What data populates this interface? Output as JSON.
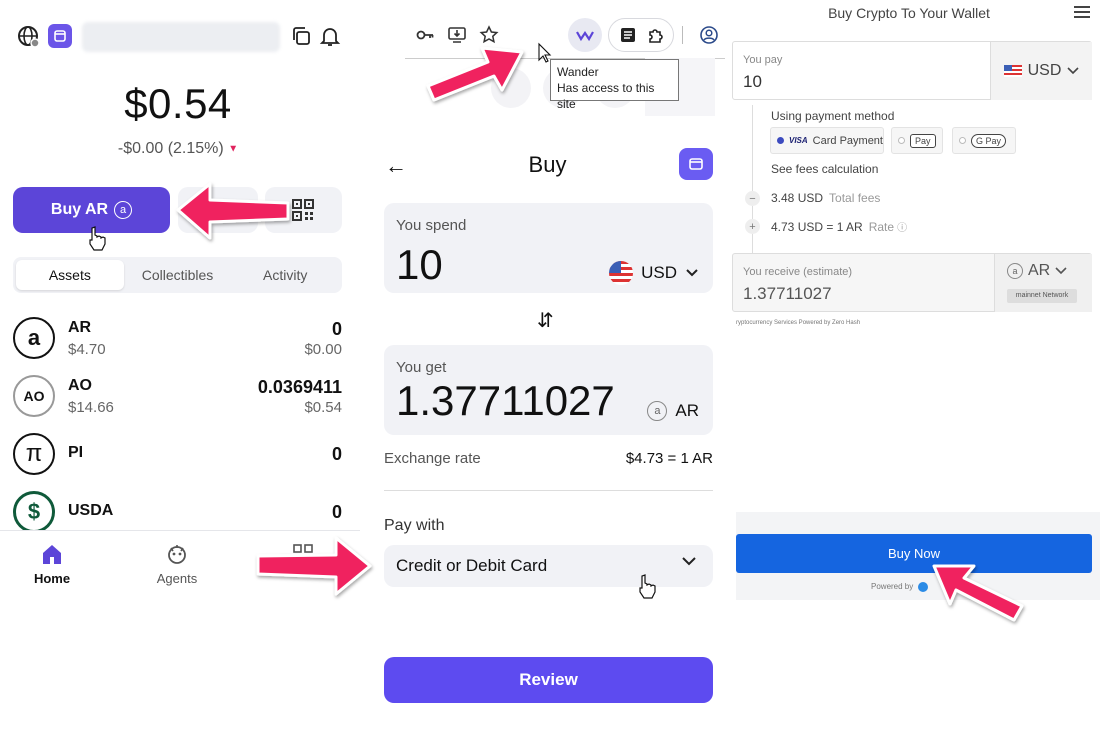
{
  "wallet": {
    "balance": "$0.54",
    "change": "-$0.00 (2.15%)",
    "change_indicator": "▼",
    "buy_button_label": "Buy AR",
    "buy_button_icon": "a",
    "tabs": [
      "Assets",
      "Collectibles",
      "Activity"
    ],
    "assets": [
      {
        "symbol": "AR",
        "logo": "a",
        "usd_price": "$4.70",
        "quantity": "0",
        "value": "$0.00"
      },
      {
        "symbol": "AO",
        "logo": "AO",
        "usd_price": "$14.66",
        "quantity": "0.0369411",
        "value": "$0.54"
      },
      {
        "symbol": "PI",
        "logo": "π",
        "usd_price": "",
        "quantity": "0",
        "value": ""
      },
      {
        "symbol": "USDA",
        "logo": "$",
        "usd_price": "",
        "quantity": "0",
        "value": ""
      }
    ],
    "nav": [
      "Home",
      "Agents"
    ],
    "accent_color": "#5c45d8"
  },
  "browser": {
    "tooltip_title": "Wander",
    "tooltip_desc": "Has access to this site"
  },
  "buy": {
    "title": "Buy",
    "spend_label": "You spend",
    "spend_value": "10",
    "spend_currency": "USD",
    "get_label": "You get",
    "get_value": "1.37711027",
    "get_currency": "AR",
    "get_currency_icon": "a",
    "exchange_rate_label": "Exchange rate",
    "exchange_rate_value": "$4.73 = 1 AR",
    "pay_with_label": "Pay with",
    "pay_with_value": "Credit or Debit Card",
    "review_label": "Review",
    "accent_color": "#5d4bf0"
  },
  "provider": {
    "title": "Buy Crypto To Your Wallet",
    "you_pay_label": "You pay",
    "you_pay_value": "10",
    "pay_currency": "USD",
    "payment_method_label": "Using payment method",
    "methods": [
      "Card Payment",
      "Apple Pay",
      "G Pay"
    ],
    "card_brand": "VISA",
    "apple_pay_label": "Pay",
    "fees_link": "See fees calculation",
    "fees_value": "3.48 USD",
    "fees_label": "Total fees",
    "rate_value": "4.73 USD = 1 AR",
    "rate_label": "Rate",
    "receive_label": "You receive (estimate)",
    "receive_value": "1.37711027",
    "receive_currency": "AR",
    "receive_currency_icon": "a",
    "network_label": "mainnet Network",
    "fine_print": "ryptocurrency Services Powered by Zero Hash",
    "buy_now_label": "Buy Now",
    "powered_by": "Powered by",
    "button_color": "#1565e0"
  },
  "annotation_color": "#f0245e"
}
